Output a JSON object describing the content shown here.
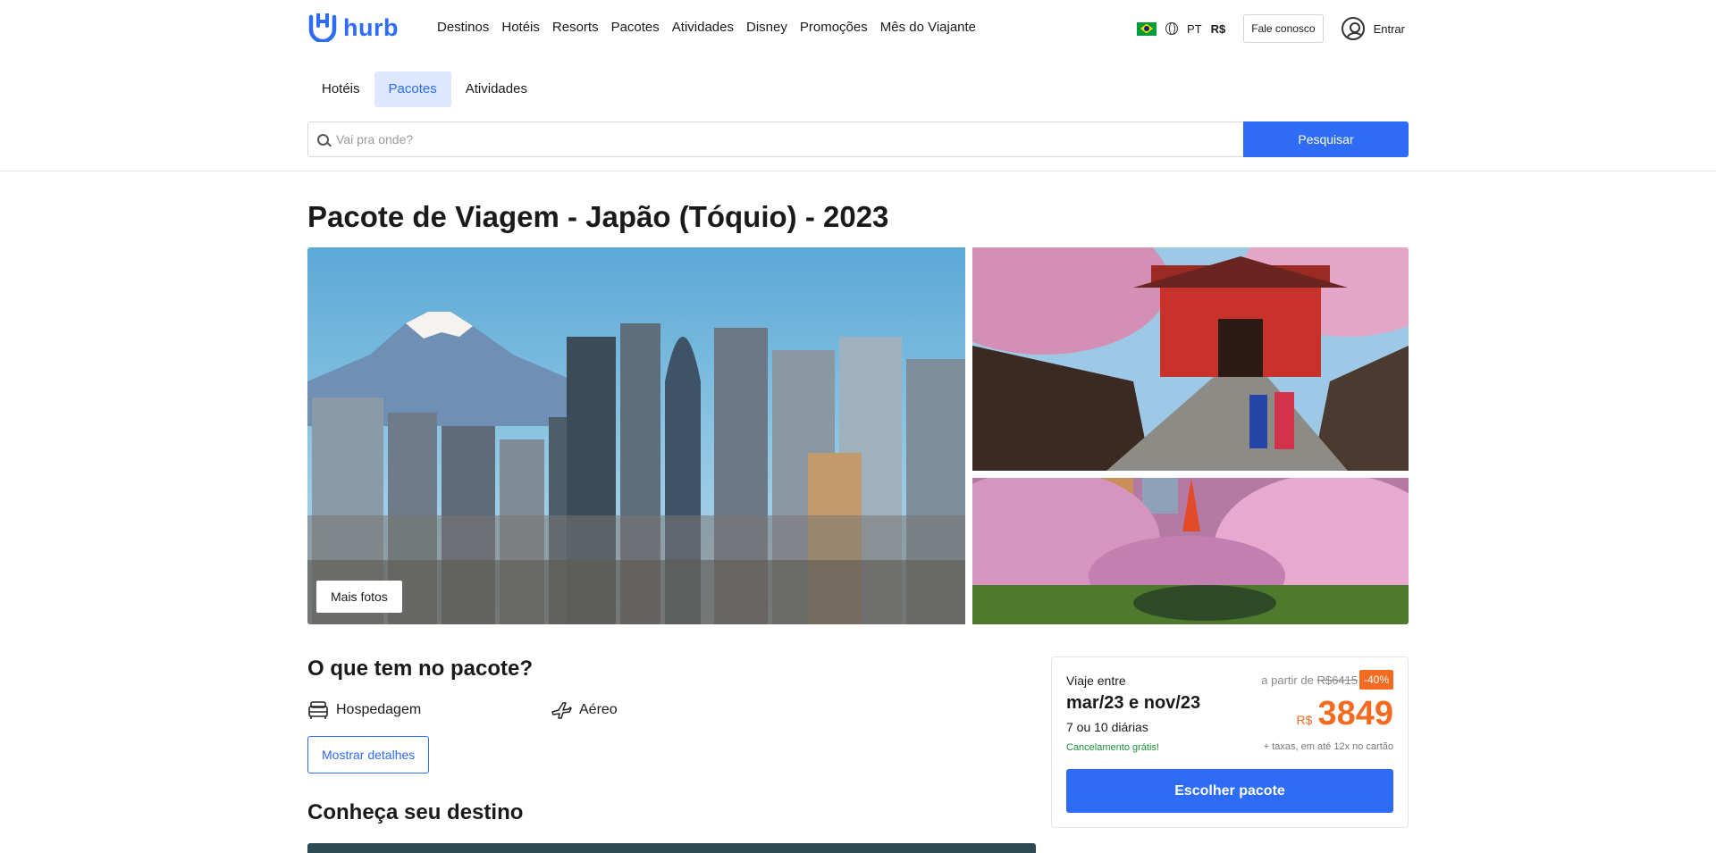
{
  "brand": {
    "name": "hurb",
    "color": "#2e6cf5"
  },
  "nav": [
    "Destinos",
    "Hotéis",
    "Resorts",
    "Pacotes",
    "Atividades",
    "Disney",
    "Promoções",
    "Mês do Viajante"
  ],
  "tools": {
    "language": "PT",
    "currency": "R$",
    "contact": "Fale conosco",
    "login": "Entrar"
  },
  "subtabs": {
    "items": [
      "Hotéis",
      "Pacotes",
      "Atividades"
    ],
    "active": "Pacotes"
  },
  "search": {
    "placeholder": "Vai pra onde?",
    "button": "Pesquisar"
  },
  "page": {
    "title": "Pacote de Viagem - Japão (Tóquio) - 2023"
  },
  "gallery": {
    "more_photos": "Mais fotos"
  },
  "package": {
    "title": "O que tem no pacote?",
    "items": [
      "Hospedagem",
      "Aéreo"
    ],
    "details_button": "Mostrar detalhes"
  },
  "destination": {
    "title": "Conheça seu destino"
  },
  "price_card": {
    "travel_label": "Viaje entre",
    "dates": "mar/23 e nov/23",
    "nights": "7 ou 10 diárias",
    "cancel": "Cancelamento grátis!",
    "from_label": "a partir de",
    "old_price": "R$6415",
    "discount": "-40%",
    "currency": "R$",
    "price": "3849",
    "taxes": "+ taxas, em até 12x no cartão",
    "button": "Escolher pacote",
    "accent_color": "#f26b21"
  }
}
